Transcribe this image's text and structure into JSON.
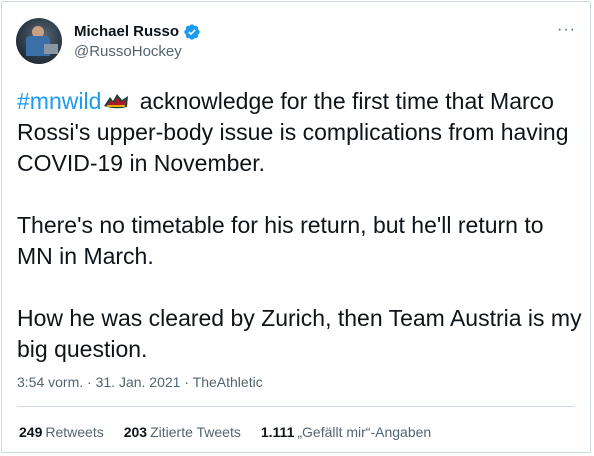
{
  "author": {
    "display_name": "Michael Russo",
    "handle": "@RussoHockey",
    "verified": true,
    "avatar_icon": "profile-photo"
  },
  "tweet": {
    "hashtag": "#mnwild",
    "hashtag_emoji_icon": "minnesota-wild-logo-icon",
    "line1_rest": " acknowledge for the first time that Marco Rossi's upper-body issue is complications from having COVID-19 in November.",
    "paragraph2": "There's no timetable for his return, but he'll return to MN in March.",
    "paragraph3": "How he was cleared by Zurich, then Team Austria is my big question."
  },
  "meta": {
    "time": "3:54 vorm.",
    "separator1": " · ",
    "date": "31. Jan. 2021",
    "separator2": " · ",
    "source": "TheAthletic"
  },
  "stats": {
    "retweets_count": "249",
    "retweets_label": "Retweets",
    "quotes_count": "203",
    "quotes_label": "Zitierte Tweets",
    "likes_count": "1.111",
    "likes_label": "„Gefällt mir“-Angaben"
  },
  "colors": {
    "link": "#1d9bf0",
    "verified": "#1d9bf0",
    "secondary_text": "#536471",
    "border": "#cfd9de"
  }
}
